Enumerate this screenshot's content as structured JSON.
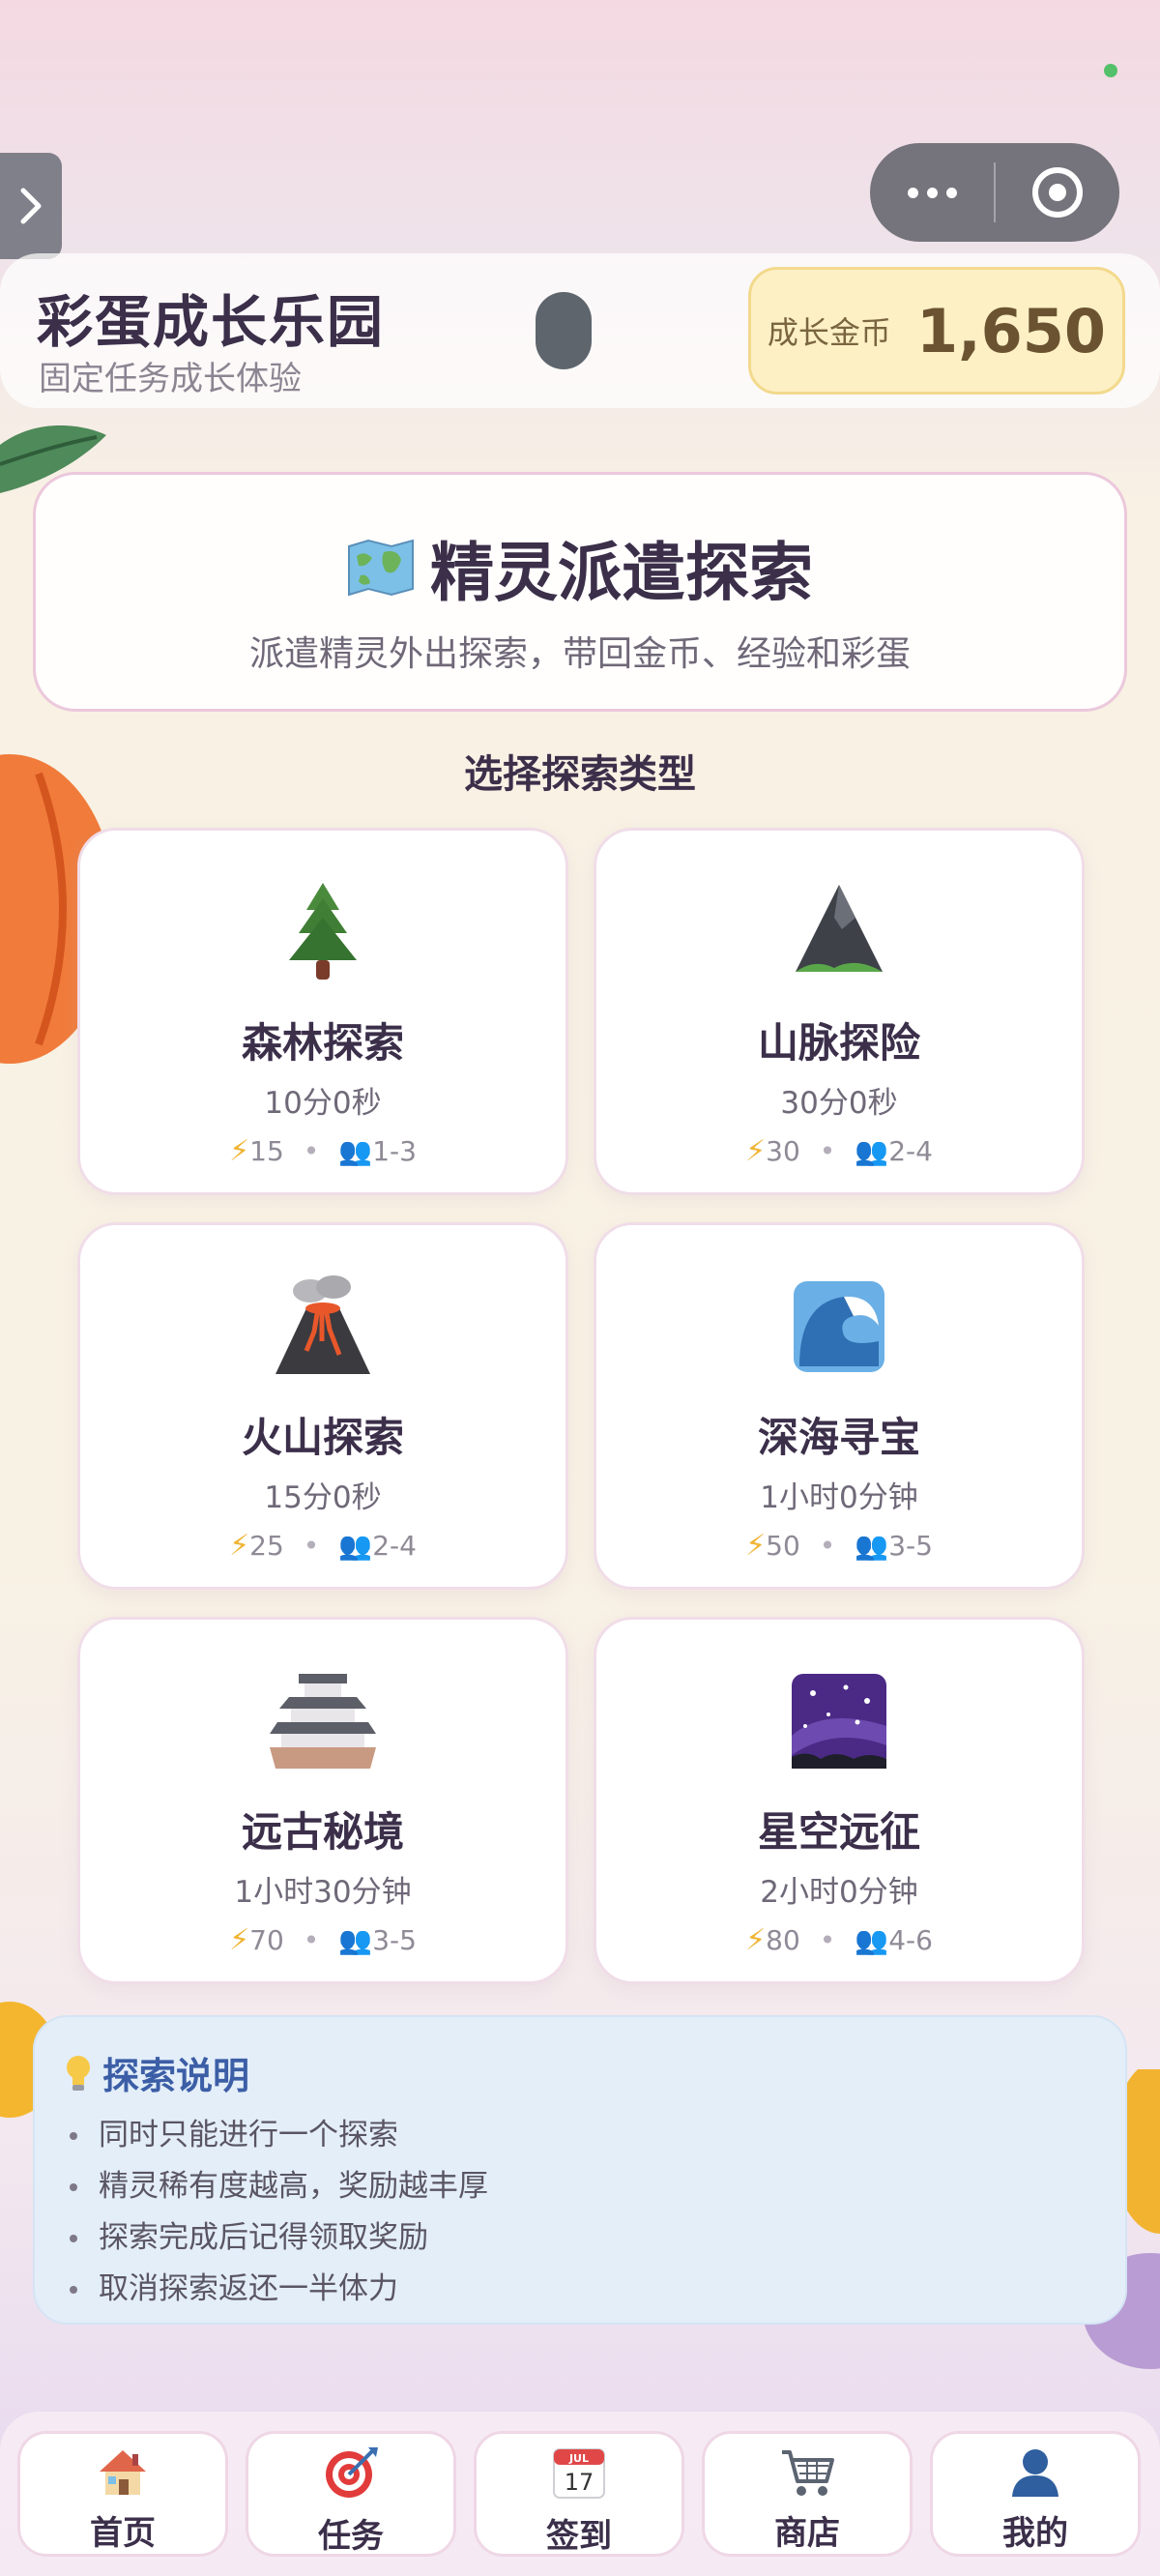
{
  "header": {
    "title": "彩蛋成长乐园",
    "subtitle": "固定任务成长体验",
    "coin_label": "成长金币",
    "coin_value": "1,650"
  },
  "hero": {
    "icon": "map-icon",
    "title": "精灵派遣探索",
    "subtitle": "派遣精灵外出探索，带回金币、经验和彩蛋"
  },
  "section_title": "选择探索类型",
  "explorations": [
    {
      "icon": "pine-tree-icon",
      "name": "森林探索",
      "duration": "10分0秒",
      "energy": "15",
      "spirits": "1-3"
    },
    {
      "icon": "mountain-icon",
      "name": "山脉探险",
      "duration": "30分0秒",
      "energy": "30",
      "spirits": "2-4"
    },
    {
      "icon": "volcano-icon",
      "name": "火山探索",
      "duration": "15分0秒",
      "energy": "25",
      "spirits": "2-4"
    },
    {
      "icon": "wave-icon",
      "name": "深海寻宝",
      "duration": "1小时0分钟",
      "energy": "50",
      "spirits": "3-5"
    },
    {
      "icon": "castle-icon",
      "name": "远古秘境",
      "duration": "1小时30分钟",
      "energy": "70",
      "spirits": "3-5"
    },
    {
      "icon": "starry-sky-icon",
      "name": "星空远征",
      "duration": "2小时0分钟",
      "energy": "80",
      "spirits": "4-6"
    }
  ],
  "info": {
    "icon": "lightbulb-icon",
    "title": "探索说明",
    "items": [
      "同时只能进行一个探索",
      "精灵稀有度越高，奖励越丰厚",
      "探索完成后记得领取奖励",
      "取消探索返还一半体力"
    ]
  },
  "nav": [
    {
      "icon": "home-icon",
      "label": "首页"
    },
    {
      "icon": "target-icon",
      "label": "任务"
    },
    {
      "icon": "calendar-icon",
      "label": "签到",
      "calendar_month": "JUL",
      "calendar_day": "17"
    },
    {
      "icon": "cart-icon",
      "label": "商店"
    },
    {
      "icon": "user-icon",
      "label": "我的"
    }
  ],
  "colors": {
    "accent_title": "#3b2f4a",
    "coin_bg": "#fdf0c5",
    "info_bg": "#e3eef9",
    "info_title": "#3c5ea6"
  }
}
